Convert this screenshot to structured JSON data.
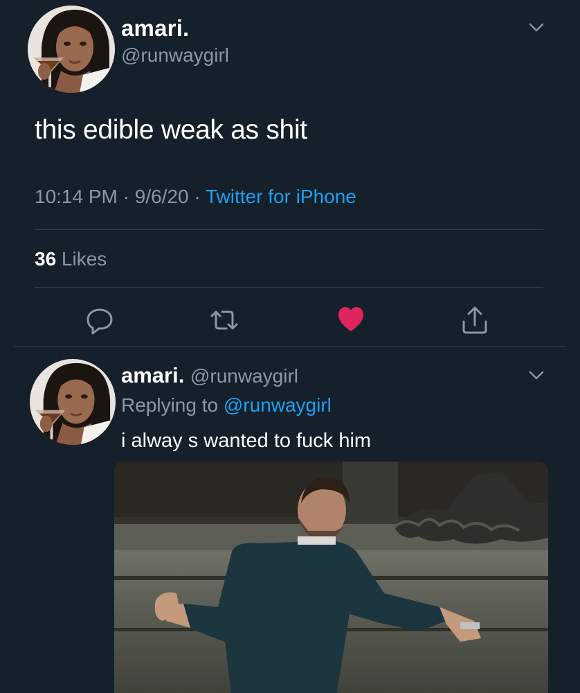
{
  "colors": {
    "background": "#15202b",
    "secondary_text": "#8899a6",
    "link": "#1da1f2",
    "like_active": "#e0245e",
    "divider": "#38444d"
  },
  "main_tweet": {
    "display_name": "amari.",
    "handle": "@runwaygirl",
    "text": "this edible weak as shit",
    "time": "10:14 PM",
    "sep1": " · ",
    "date": "9/6/20",
    "sep2": " · ",
    "source": "Twitter for iPhone",
    "likes_count": "36",
    "likes_label": " Likes",
    "actions": [
      "reply-icon",
      "retweet-icon",
      "like-icon",
      "share-icon"
    ],
    "liked": true
  },
  "reply_tweet": {
    "display_name": "amari.",
    "handle": "@runwaygirl",
    "replying_prefix": "Replying to ",
    "replying_to": "@runwaygirl",
    "text": "i alway s wanted to fuck him"
  }
}
